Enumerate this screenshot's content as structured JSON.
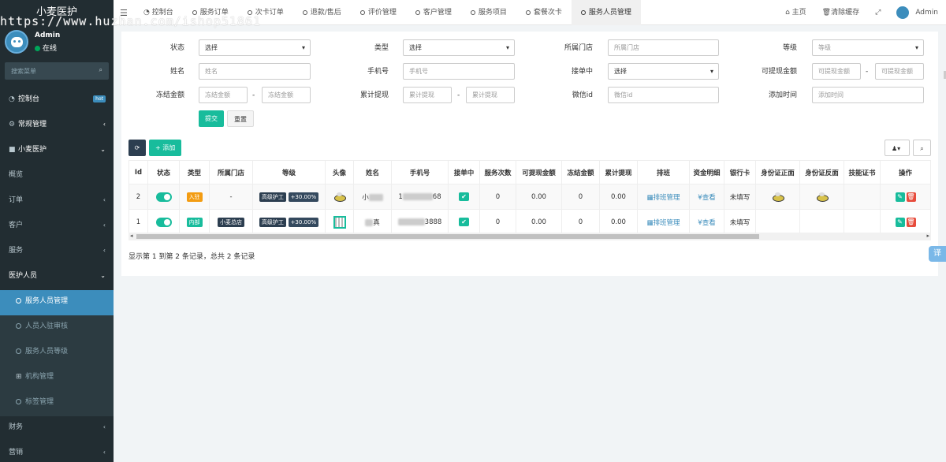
{
  "app": {
    "title": "小麦医护",
    "watermark": "https://www.huzhan.com/ishop51861"
  },
  "user": {
    "name": "Admin",
    "status": "在线"
  },
  "search": {
    "placeholder": "搜索菜单"
  },
  "menu": {
    "dashboard": "控制台",
    "hot": "hot",
    "general": "常规管理",
    "xiaomai": "小麦医护",
    "overview": "概览",
    "orders": "订单",
    "customers": "客户",
    "services": "服务",
    "medical": "医护人员",
    "staff_mgmt": "服务人员管理",
    "staff_audit": "人员入驻审核",
    "staff_level": "服务人员等级",
    "org_mgmt": "机构管理",
    "tag_mgmt": "标签管理",
    "finance": "财务",
    "marketing": "营销"
  },
  "tabs": [
    "控制台",
    "服务订单",
    "次卡订单",
    "退款/售后",
    "评价管理",
    "客户管理",
    "服务项目",
    "套餐次卡",
    "服务人员管理"
  ],
  "toolbar_right": {
    "home": "主页",
    "clear_cache": "清除缓存",
    "admin": "Admin"
  },
  "filters": {
    "status": {
      "label": "状态",
      "value": "选择"
    },
    "type": {
      "label": "类型",
      "value": "选择"
    },
    "store": {
      "label": "所属门店",
      "placeholder": "所属门店"
    },
    "level": {
      "label": "等级",
      "placeholder": "等级"
    },
    "name": {
      "label": "姓名",
      "placeholder": "姓名"
    },
    "phone": {
      "label": "手机号",
      "placeholder": "手机号"
    },
    "accepting": {
      "label": "接单中",
      "value": "选择"
    },
    "withdrawable": {
      "label": "可提现金额",
      "ph1": "可提现金额",
      "ph2": "可提现金额"
    },
    "frozen": {
      "label": "冻结金额",
      "ph1": "冻结金额",
      "ph2": "冻结金额"
    },
    "total_withdraw": {
      "label": "累计提现",
      "ph1": "累计提现",
      "ph2": "累计提现"
    },
    "wechat": {
      "label": "微信id",
      "placeholder": "微信id"
    },
    "added": {
      "label": "添加时间",
      "placeholder": "添加时间"
    },
    "dash": "-",
    "submit": "提交",
    "reset": "重置"
  },
  "actions": {
    "refresh": "⟳",
    "add": "+ 添加",
    "export": "▾",
    "search": "⌕"
  },
  "table": {
    "headers": [
      "Id",
      "状态",
      "类型",
      "所属门店",
      "等级",
      "头像",
      "姓名",
      "手机号",
      "接单中",
      "服务次数",
      "可提现金额",
      "冻结金额",
      "累计提现",
      "排班",
      "资金明细",
      "银行卡",
      "身份证正面",
      "身份证反面",
      "技能证书",
      "操作"
    ],
    "rows": [
      {
        "id": "2",
        "type": "入驻",
        "store": "-",
        "level": "高级护工",
        "rate": "+30.00%",
        "name": "小",
        "phone": "1",
        "phone_tail": "68",
        "count": "0",
        "withdrawable": "0.00",
        "frozen": "0",
        "total": "0.00",
        "schedule": "排班管理",
        "detail": "¥查看",
        "bank": "未填写"
      },
      {
        "id": "1",
        "type": "内部",
        "store": "小麦总店",
        "level": "高级护工",
        "rate": "+30.00%",
        "name": "真",
        "phone": "",
        "phone_tail": "3888",
        "count": "0",
        "withdrawable": "0.00",
        "frozen": "0",
        "total": "0.00",
        "schedule": "排班管理",
        "detail": "¥查看",
        "bank": "未填写"
      }
    ]
  },
  "pager": "显示第 1 到第 2 条记录，总共 2 条记录",
  "translate": "译"
}
